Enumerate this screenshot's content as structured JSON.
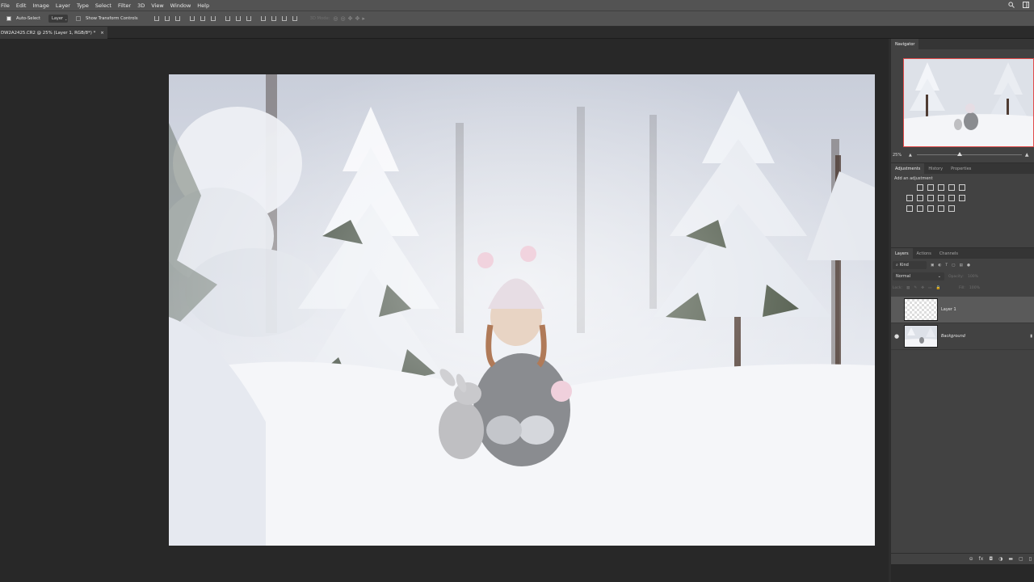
{
  "menu": [
    "File",
    "Edit",
    "Image",
    "Layer",
    "Type",
    "Select",
    "Filter",
    "3D",
    "View",
    "Window",
    "Help"
  ],
  "options": {
    "auto_select_label": "Auto-Select",
    "layer_select_value": "Layer",
    "show_transform_label": "Show Transform Controls",
    "mode_3d_label": "3D Mode:"
  },
  "document_tab": {
    "title": "DW2A2425.CR2 @ 25% (Layer 1, RGB/8*) *",
    "close": "×"
  },
  "navigator": {
    "title": "Navigator",
    "zoom": "25%"
  },
  "adjustments": {
    "tabs": [
      "Adjustments",
      "History",
      "Properties"
    ],
    "add_label": "Add an adjustment"
  },
  "layers": {
    "tabs": [
      "Layers",
      "Actions",
      "Channels"
    ],
    "kind_label": "Kind",
    "blend_mode": "Normal",
    "opacity_label": "Opacity:",
    "opacity_value": "100%",
    "lock_label": "Lock:",
    "fill_label": "Fill:",
    "fill_value": "100%",
    "items": [
      {
        "name": "Layer 1",
        "visible": false,
        "selected": true
      },
      {
        "name": "Background",
        "visible": true,
        "selected": false
      }
    ]
  },
  "colors": {
    "accent_red": "#e24a4a",
    "panel": "#424242",
    "ui": "#535353",
    "canvas": "#282828"
  },
  "icons": [
    "search-icon",
    "workspace-icon",
    "eye-icon",
    "lock-icon",
    "link-icon",
    "fx-icon",
    "mask-icon",
    "adjustment-icon",
    "folder-icon",
    "new-layer-icon",
    "trash-icon"
  ]
}
